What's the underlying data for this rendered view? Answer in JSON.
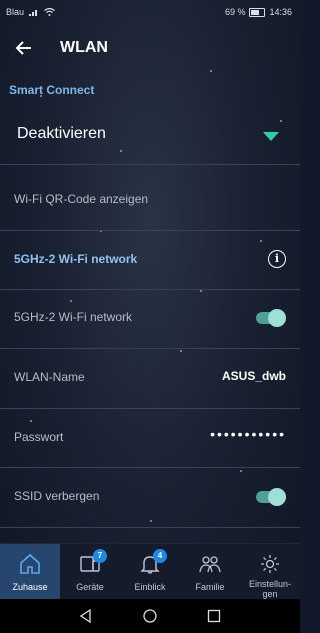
{
  "status_bar": {
    "carrier": "Blau",
    "battery": "69 %",
    "time": "14:36"
  },
  "header": {
    "title": "WLAN"
  },
  "smart_connect": {
    "label": "Smart Connect",
    "value": "Deaktivieren"
  },
  "rows": [
    {
      "label": "Wi-Fi QR-Code anzeigen"
    },
    {
      "label": "5GHz-2 Wi-Fi network"
    },
    {
      "label": "5GHz-2 Wi-Fi network",
      "toggle_on": true
    },
    {
      "label": "WLAN-Name",
      "value": "ASUS_dwb"
    },
    {
      "label": "Passwort",
      "value": "•••••••••••"
    },
    {
      "label": "SSID verbergen",
      "toggle_on": true
    }
  ],
  "tabs": [
    {
      "label": "Zuhause",
      "active": true
    },
    {
      "label": "Geräte",
      "badge": "7"
    },
    {
      "label": "Einblick",
      "badge": "4"
    },
    {
      "label": "Familie"
    },
    {
      "label": "Einstellun-\ngen"
    }
  ],
  "colors": {
    "accent": "#2ad0a6",
    "link_blue": "#8fc3ef",
    "active_tab": "#27466e"
  }
}
